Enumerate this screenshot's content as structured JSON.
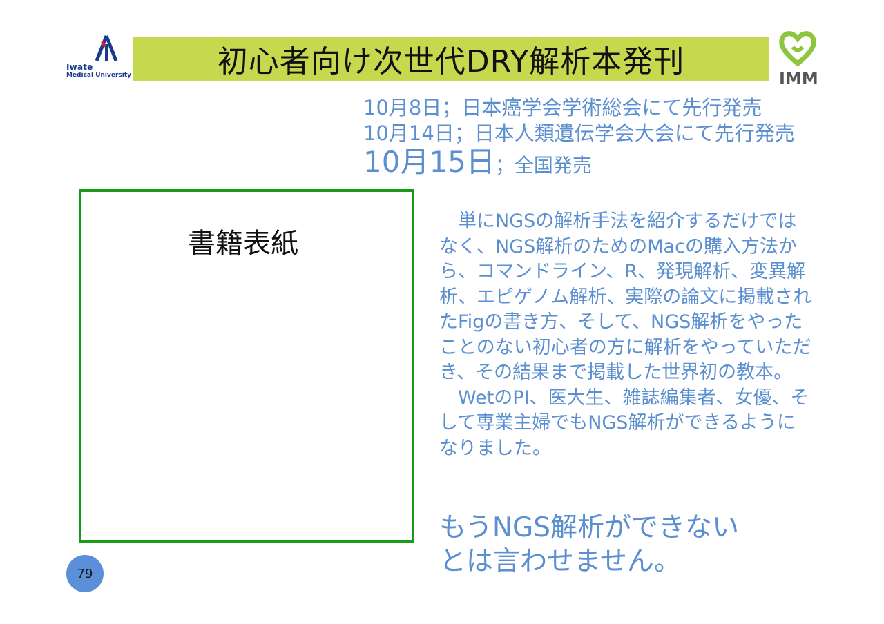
{
  "logos": {
    "university_line1": "Iwate",
    "university_line2": "Medical University",
    "imm": "IMM"
  },
  "title": "初心者向け次世代DRY解析本発刊",
  "release": {
    "line1": "10月8日；日本癌学会学術総会にて先行発売",
    "line2": "10月14日；日本人類遺伝学会大会にて先行発売",
    "line3_date": "10月15日",
    "line3_text": "；全国発売"
  },
  "cover_placeholder": "書籍表紙",
  "description": [
    "　単にNGSの解析手法を紹介するだけではなく、NGS解析のためのMacの購入方法から、コマンドライン、R、発現解析、変異解析、エピゲノム解析、実際の論文に掲載されたFigの書き方、そして、NGS解析をやったことのない初心者の方に解析をやっていただき、その結果まで掲載した世界初の教本。",
    "　WetのPI、医大生、雑誌編集者、女優、そして専業主婦でもNGS解析ができるようになりました。"
  ],
  "tagline": [
    "もうNGS解析ができない",
    "とは言わせません。"
  ],
  "page_number": "79",
  "colors": {
    "title_bar": "#c6d94e",
    "body_text": "#5b8fd0",
    "cover_border": "#1a9a1a",
    "page_badge": "#5b8fd8"
  }
}
